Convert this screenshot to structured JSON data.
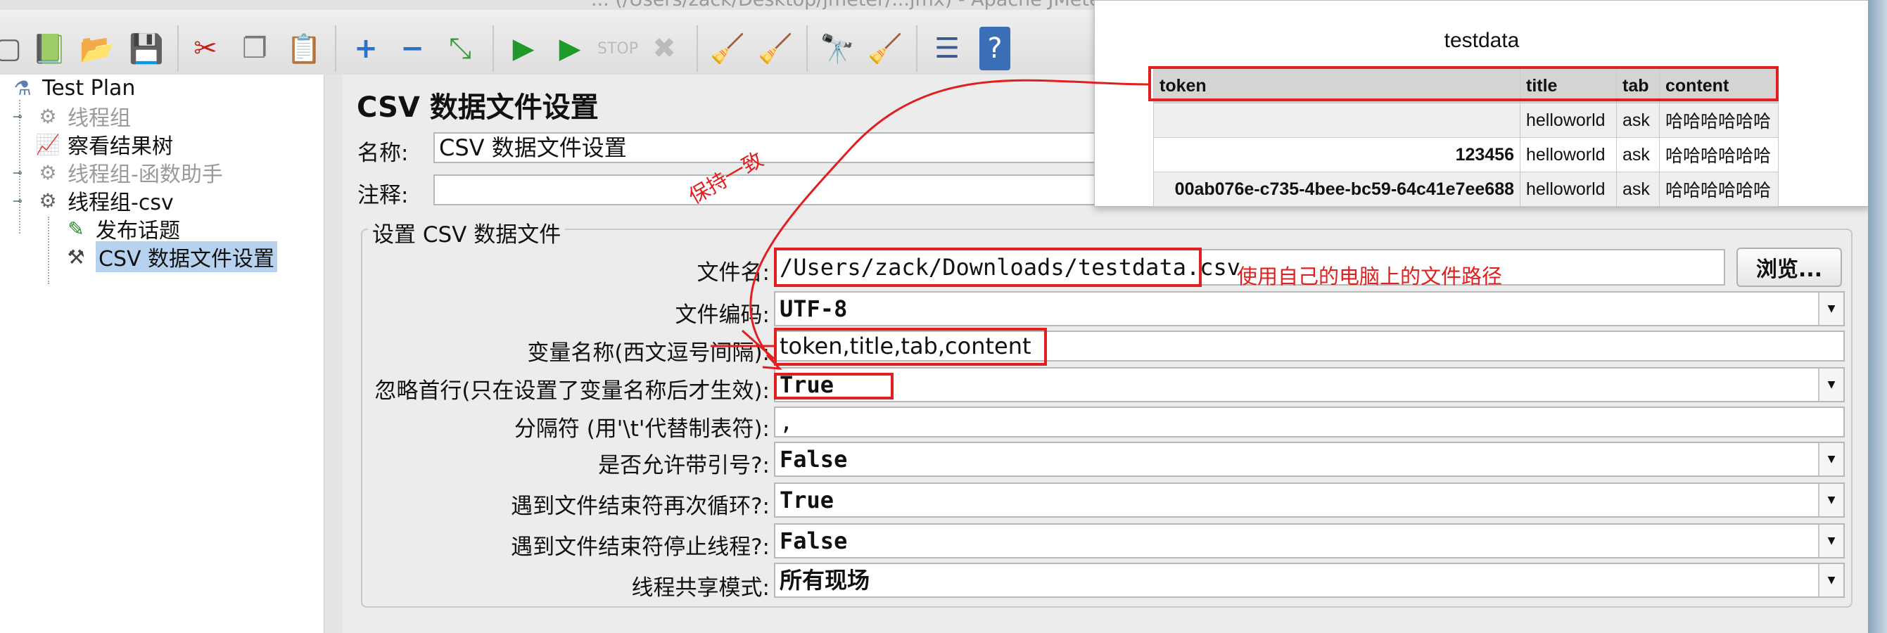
{
  "window": {
    "title": "... (/Users/zack/Desktop/jmeter/...jmx) - Apache JMeter"
  },
  "toolbar": {
    "icons": [
      "new-icon",
      "templates-icon",
      "open-icon",
      "save-icon",
      "cut-icon",
      "copy-icon",
      "paste-icon",
      "expand-icon",
      "collapse-icon",
      "toggle-icon",
      "start-icon",
      "start-no-pause-icon",
      "stop-icon",
      "shutdown-icon",
      "clear-icon",
      "clear-all-icon",
      "search-icon",
      "reset-search-icon",
      "function-helper-icon",
      "help-icon"
    ]
  },
  "tree": {
    "items": [
      {
        "label": "Test Plan"
      },
      {
        "label": "线程组"
      },
      {
        "label": "察看结果树"
      },
      {
        "label": "线程组-函数助手"
      },
      {
        "label": "线程组-csv"
      },
      {
        "label": "发布话题"
      },
      {
        "label": "CSV 数据文件设置"
      }
    ]
  },
  "panel": {
    "title": "CSV 数据文件设置",
    "name_label": "名称:",
    "name_value": "CSV 数据文件设置",
    "comment_label": "注释:",
    "comment_value": "",
    "group_title": "设置 CSV 数据文件",
    "fields": {
      "filename_label": "文件名:",
      "filename_value": "/Users/zack/Downloads/testdata.csv",
      "browse_label": "浏览...",
      "encoding_label": "文件编码:",
      "encoding_value": "UTF-8",
      "varnames_label": "变量名称(西文逗号间隔):",
      "varnames_value": "token,title,tab,content",
      "ignore_first_label": "忽略首行(只在设置了变量名称后才生效):",
      "ignore_first_value": "True",
      "delimiter_label": "分隔符 (用'\\t'代替制表符):",
      "delimiter_value": ",",
      "quoted_label": "是否允许带引号?:",
      "quoted_value": "False",
      "recycle_label": "遇到文件结束符再次循环?:",
      "recycle_value": "True",
      "stop_label": "遇到文件结束符停止线程?:",
      "stop_value": "False",
      "share_label": "线程共享模式:",
      "share_value": "所有现场"
    }
  },
  "testdata": {
    "title": "testdata",
    "columns": [
      "token",
      "title",
      "tab",
      "content"
    ],
    "rows": [
      [
        "",
        "helloworld",
        "ask",
        "哈哈哈哈哈哈"
      ],
      [
        "123456",
        "helloworld",
        "ask",
        "哈哈哈哈哈哈"
      ],
      [
        "00ab076e-c735-4bee-bc59-64c41e7ee688",
        "helloworld",
        "ask",
        "哈哈哈哈哈哈"
      ]
    ]
  },
  "annotations": {
    "keep_consistent": "保持一致",
    "use_own_path": "使用自己的电脑上的文件路径",
    "color": "#e02020"
  }
}
